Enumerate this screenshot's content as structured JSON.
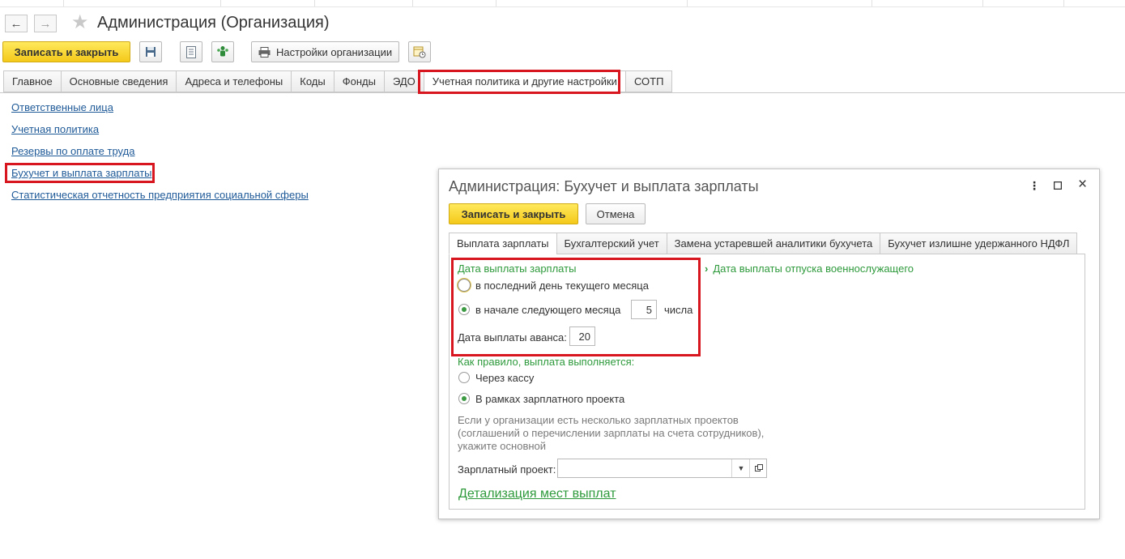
{
  "window": {
    "title": "Администрация (Организация)"
  },
  "toolbar": {
    "save_close": "Записать и закрыть",
    "org_settings": "Настройки организации"
  },
  "tabs": [
    {
      "label": "Главное"
    },
    {
      "label": "Основные сведения"
    },
    {
      "label": "Адреса и телефоны"
    },
    {
      "label": "Коды"
    },
    {
      "label": "Фонды"
    },
    {
      "label": "ЭДО"
    },
    {
      "label": "Учетная политика и другие настройки",
      "active": true
    },
    {
      "label": "СОТП"
    }
  ],
  "links": [
    {
      "label": "Ответственные лица"
    },
    {
      "label": "Учетная политика"
    },
    {
      "label": "Резервы по оплате труда"
    },
    {
      "label": "Бухучет и выплата зарплаты"
    },
    {
      "label": "Статистическая отчетность предприятия социальной сферы"
    }
  ],
  "dialog": {
    "title": "Администрация: Бухучет и выплата зарплаты",
    "save_close": "Записать и закрыть",
    "cancel": "Отмена",
    "tabs": [
      {
        "label": "Выплата зарплаты",
        "active": true
      },
      {
        "label": "Бухгалтерский учет"
      },
      {
        "label": "Замена устаревшей аналитики бухучета"
      },
      {
        "label": "Бухучет излишне удержанного НДФЛ"
      }
    ],
    "pay_date_header": "Дата выплаты зарплаты",
    "military_link": "Дата выплаты отпуска военнослужащего",
    "option_last_day": "в последний день текущего месяца",
    "option_next_month": "в начале следующего месяца",
    "day_value": "5",
    "day_suffix": "числа",
    "advance_label": "Дата выплаты аванса:",
    "advance_value": "20",
    "payment_header": "Как правило, выплата выполняется:",
    "option_cash": "Через кассу",
    "option_project": "В рамках зарплатного проекта",
    "hint_line1": "Если у организации есть несколько зарплатных проектов",
    "hint_line2": "(соглашений о перечислении зарплаты на счета сотрудников),",
    "hint_line3": "укажите основной",
    "project_label": "Зарплатный проект:",
    "project_value": "",
    "details_link": "Детализация мест выплат"
  },
  "colors": {
    "accent_yellow": "#f4c91a",
    "highlight_red": "#d7161f",
    "link_blue": "#1f5a98",
    "green": "#2e9a3c"
  }
}
